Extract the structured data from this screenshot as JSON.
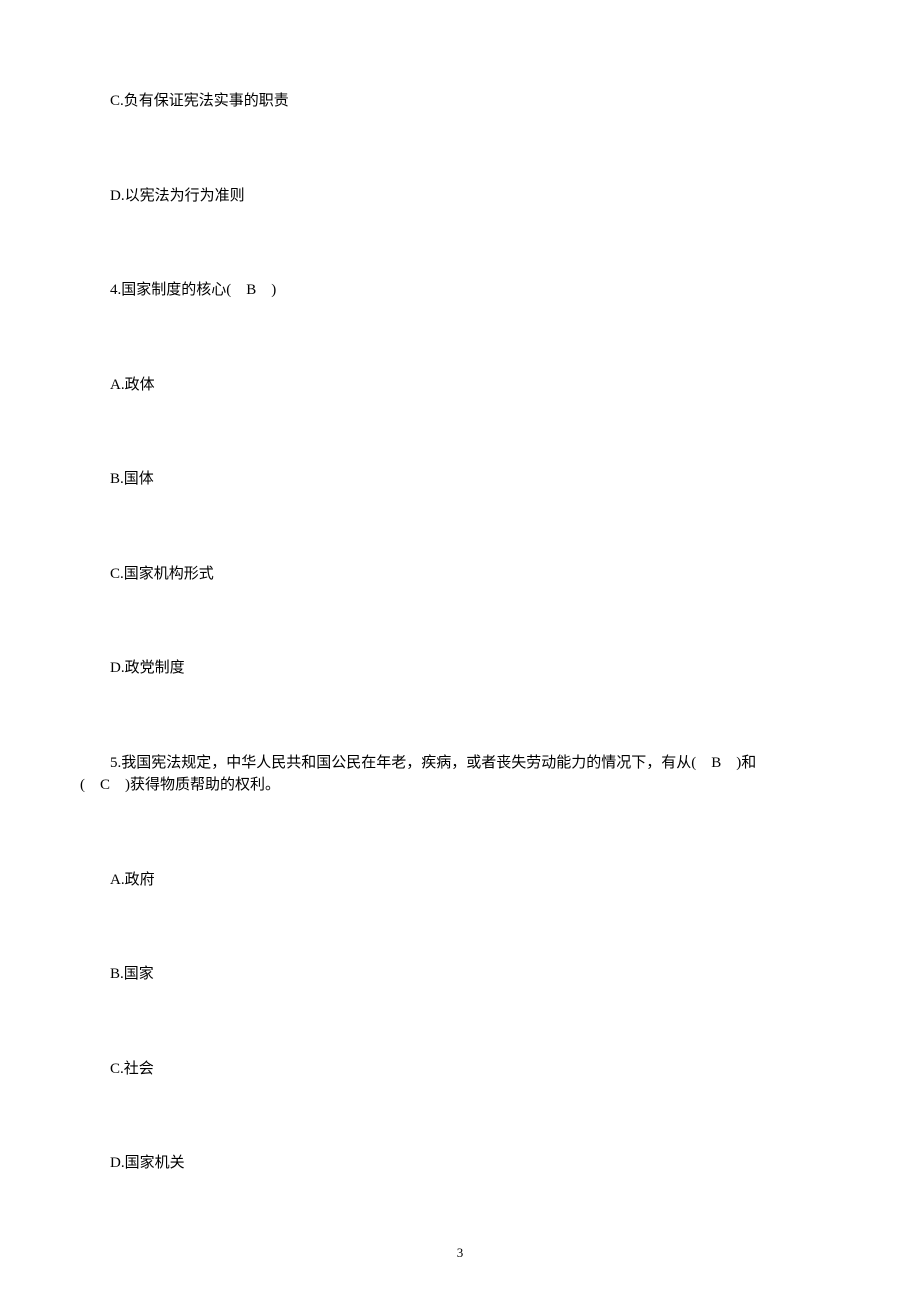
{
  "lines": {
    "optC": "C.负有保证宪法实事的职责",
    "optD": "D.以宪法为行为准则",
    "q4": "4.国家制度的核心(　B　)",
    "q4A": "A.政体",
    "q4B": "B.国体",
    "q4C": "C.国家机构形式",
    "q4D": "D.政党制度",
    "q5_l1": "5.我国宪法规定，中华人民共和国公民在年老，疾病，或者丧失劳动能力的情况下，有从(　B　)和",
    "q5_l2": "(　C　)获得物质帮助的权利。",
    "q5A": "A.政府",
    "q5B": "B.国家",
    "q5C": "C.社会",
    "q5D": "D.国家机关"
  },
  "pageNumber": "3"
}
